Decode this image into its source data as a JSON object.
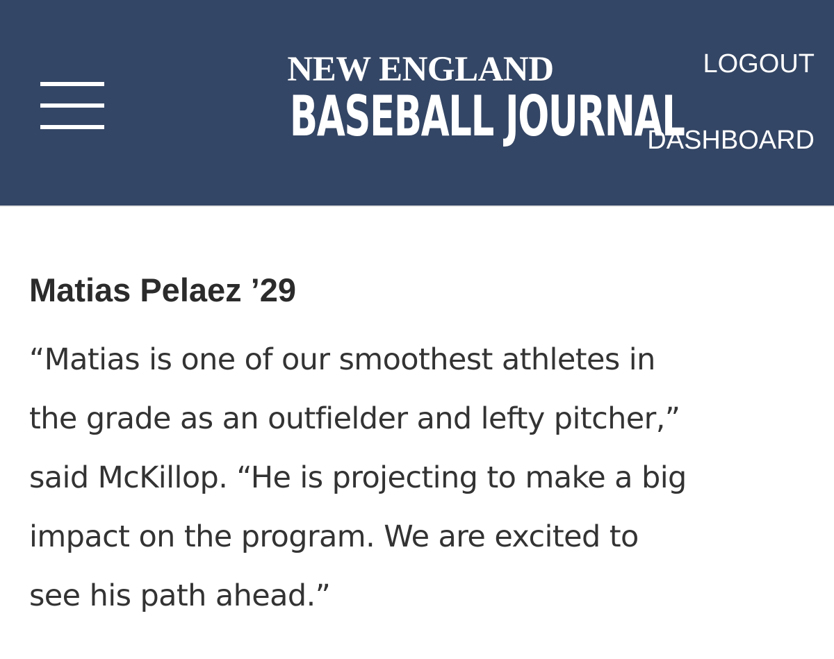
{
  "header": {
    "menu_icon": "hamburger-menu-icon",
    "logo_line1": "NEW ENGLAND",
    "logo_line2": "BASEBALL JOURNAL",
    "nav": {
      "logout": "LOGOUT",
      "dashboard": "DASHBOARD"
    },
    "background_color": "#344665"
  },
  "article": {
    "title": "Matias Pelaez ’29",
    "body_lines": [
      "“Matias is one of our smoothest athletes in",
      "the grade as an outfielder and lefty pitcher,”",
      "said McKillop. “He is projecting to make a big",
      "impact on the program. We are excited to",
      "see his path ahead.”"
    ]
  }
}
